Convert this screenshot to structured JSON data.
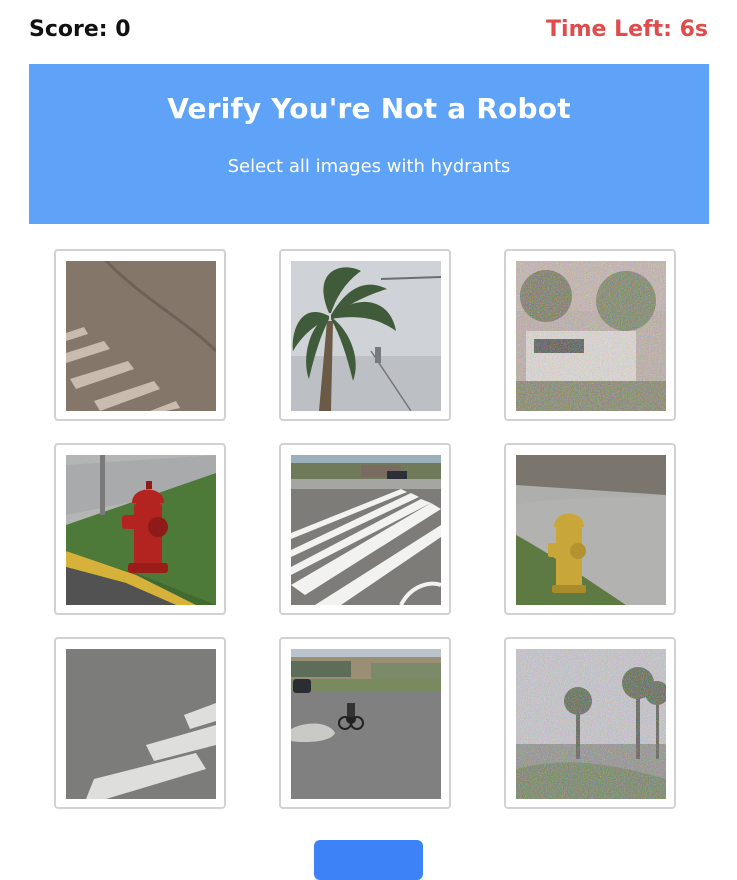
{
  "hud": {
    "score_label": "Score: 0",
    "time_label": "Time Left: 6s"
  },
  "captcha": {
    "title": "Verify You're Not a Robot",
    "instruction": "Select all images with hydrants"
  },
  "tiles": [
    {
      "subject": "crosswalk-corner"
    },
    {
      "subject": "palm-tree"
    },
    {
      "subject": "noisy-building"
    },
    {
      "subject": "red-fire-hydrant"
    },
    {
      "subject": "crosswalk-street"
    },
    {
      "subject": "yellow-fire-hydrant"
    },
    {
      "subject": "crosswalk-lines"
    },
    {
      "subject": "intersection-cyclist"
    },
    {
      "subject": "noisy-palm-street"
    }
  ],
  "colors": {
    "header_bg": "#5ea3f8",
    "timer": "#e04b4b",
    "button": "#3d82f6"
  }
}
